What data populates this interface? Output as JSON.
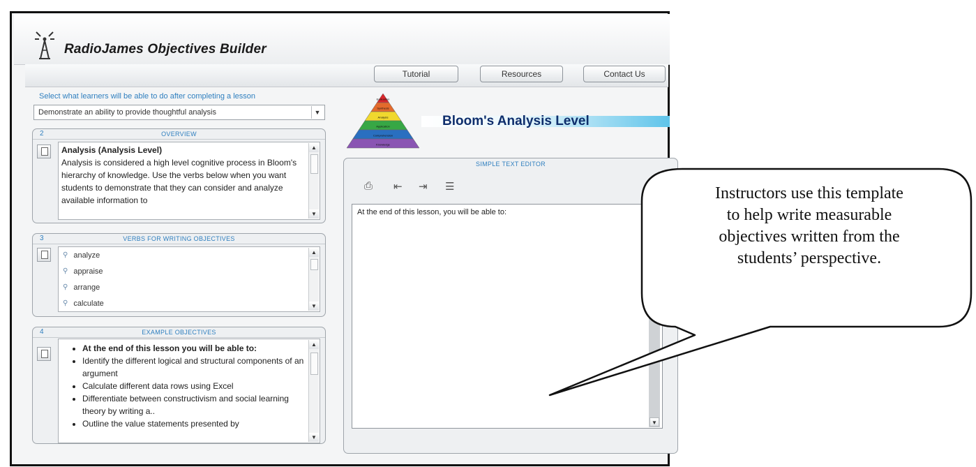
{
  "app": {
    "title": "RadioJames Objectives Builder",
    "logo_icon": "radio-tower-icon"
  },
  "nav": {
    "buttons": [
      {
        "label": "Tutorial"
      },
      {
        "label": "Resources"
      },
      {
        "label": "Contact Us"
      }
    ]
  },
  "left": {
    "prompt": "Select what learners will be able to do after completing a lesson",
    "select_value": "Demonstrate an ability to provide thoughtful analysis",
    "overview": {
      "number": "2",
      "title": "OVERVIEW",
      "heading": "Analysis (Analysis Level)",
      "body": "Analysis is considered a high level cognitive process in Bloom's hierarchy of knowledge. Use the verbs below when you want students to demonstrate that they can consider and analyze available information to"
    },
    "verbs": {
      "number": "3",
      "title": "VERBS FOR WRITING OBJECTIVES",
      "items": [
        "analyze",
        "appraise",
        "arrange",
        "calculate"
      ]
    },
    "examples": {
      "number": "4",
      "title": "EXAMPLE OBJECTIVES",
      "items": [
        "At the end of this lesson you will be able to:",
        "Identify the different logical and structural components of an argument",
        "Calculate different data rows using Excel",
        "Differentiate between constructivism and social learning theory by writing a..",
        "Outline the value statements presented by"
      ]
    }
  },
  "right": {
    "bloom_title": "Bloom's Analysis Level",
    "pyramid_levels": [
      "Evaluation",
      "Synthesis",
      "Analysis",
      "Application",
      "Comprehension",
      "Knowledge"
    ],
    "pyramid_colors": [
      "#d9262b",
      "#e36a2c",
      "#f0d82e",
      "#37a745",
      "#2a6fc0",
      "#8a55b3"
    ],
    "editor_label": "SIMPLE TEXT EDITOR",
    "editor_tools": [
      "print-icon",
      "outdent-icon",
      "indent-icon",
      "bullet-list-icon"
    ],
    "editor_text": "At the end of this lesson, you will be able to:"
  },
  "callout": {
    "lines": [
      "Instructors use this template",
      "to help write measurable",
      "objectives written from the",
      "students’ perspective."
    ]
  }
}
